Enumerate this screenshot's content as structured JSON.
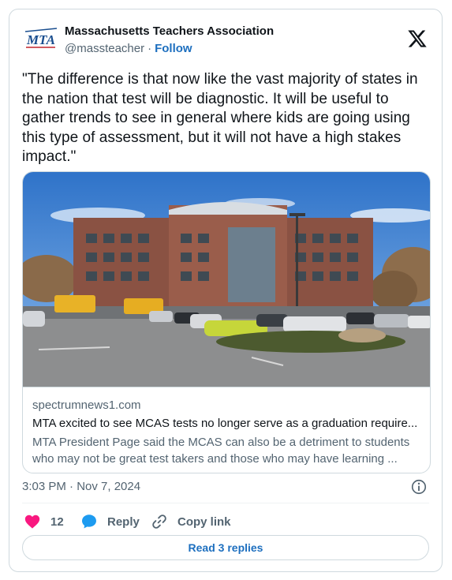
{
  "author": {
    "name": "Massachusetts Teachers Association",
    "handle": "@massteacher",
    "separator": "·",
    "follow_label": "Follow",
    "logo_text": "MTA",
    "avatar_icon": "mta-logo"
  },
  "platform_icon": "x-logo-icon",
  "tweet": {
    "text": "\"The difference is that now like the vast majority of states in the nation that test will be diagnostic. It will be useful to gather trends to see in general where kids are going using this type of assessment, but it will not have a high stakes impact.\""
  },
  "link_card": {
    "image_description_icon": "school-building-photo",
    "domain": "spectrumnews1.com",
    "title": "MTA excited to see MCAS tests no longer serve as a graduation require...",
    "description": "MTA President Page said the MCAS can also be a detriment to students who may not be great test takers and those who may have learning ..."
  },
  "meta": {
    "timestamp": "3:03 PM · Nov 7, 2024",
    "info_icon": "info-icon"
  },
  "actions": {
    "like_count": "12",
    "reply_label": "Reply",
    "copy_label": "Copy link"
  },
  "read_replies_label": "Read 3 replies",
  "colors": {
    "like": "#f91880",
    "reply": "#1d9bf0",
    "link": "#1d6fbf",
    "secondary_text": "#536471",
    "border": "#cfd9de"
  }
}
